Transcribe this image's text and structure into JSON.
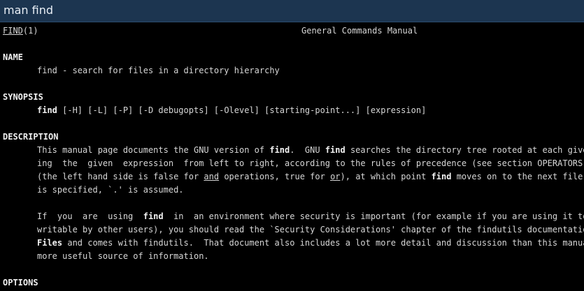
{
  "window": {
    "title": "man find"
  },
  "header": {
    "page_name": "FIND",
    "section": "(1)",
    "manual_title": "General Commands Manual"
  },
  "name_section": {
    "heading": "NAME",
    "text": "find - search for files in a directory hierarchy"
  },
  "synopsis": {
    "heading": "SYNOPSIS",
    "command": "find",
    "args": " [-H] [-L] [-P] [-D debugopts] [-Olevel] [starting-point...] [expression]"
  },
  "description": {
    "heading": "DESCRIPTION",
    "p1": {
      "l1a": "This manual page documents the GNU version of ",
      "l1b": "find",
      "l1c": ".  GNU ",
      "l1d": "find",
      "l1e": " searches the directory tree rooted at each given s",
      "l2": "ing  the  given  expression  from left to right, according to the rules of precedence (see section OPERATORS), u",
      "l3a": "(the left hand side is false for ",
      "l3b": "and",
      "l3c": " operations, true for ",
      "l3d": "or",
      "l3e": "), at which point ",
      "l3f": "find",
      "l3g": " moves on to the next file nam",
      "l4": "is specified, `.' is assumed."
    },
    "p2": {
      "l1a": "If  you  are  using  ",
      "l1b": "find",
      "l1c": "  in  an environment where security is important (for example if you are using it to se",
      "l2": "writable by other users), you should read the `Security Considerations' chapter of the findutils documentation, ",
      "l3a": "Files",
      "l3b": " and comes with findutils.  That document also includes a lot more detail and discussion than this manual p",
      "l4": "more useful source of information."
    }
  },
  "options": {
    "heading": "OPTIONS"
  }
}
